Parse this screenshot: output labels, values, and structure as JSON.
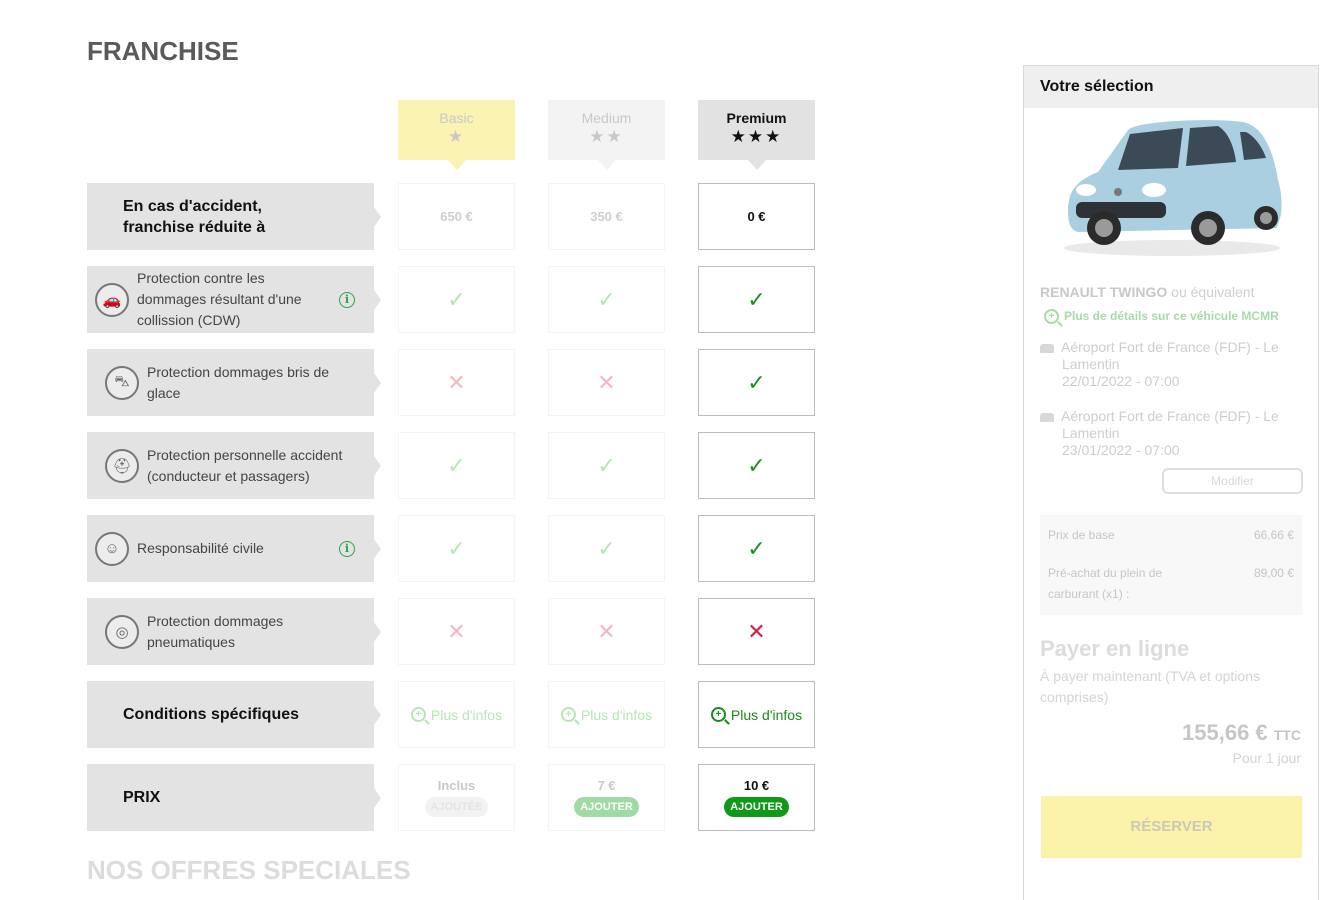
{
  "section_title": "FRANCHISE",
  "special_title": "NOS OFFRES SPECIALES",
  "plans": [
    {
      "name": "Basic",
      "stars": "★"
    },
    {
      "name": "Medium",
      "stars": "★★"
    },
    {
      "name": "Premium",
      "stars": "★★★"
    }
  ],
  "rows": {
    "franchise": {
      "label_line1": "En cas d'accident,",
      "label_line2": "franchise réduite à",
      "values": [
        "650 €",
        "350 €",
        "0 €"
      ]
    },
    "cdw": {
      "label": "Protection contre les dommages résultant d'une collission (CDW)",
      "icon": "car-crash-icon"
    },
    "glass": {
      "label": "Protection dommages bris de glace",
      "icon": "windshield-icon"
    },
    "personal": {
      "label": "Protection personnelle accident (conducteur et passagers)",
      "icon": "seatbelt-icon"
    },
    "liability": {
      "label": "Responsabilité civile",
      "icon": "driver-icon"
    },
    "tires": {
      "label": "Protection dommages pneumatiques",
      "icon": "tire-icon"
    },
    "conditions": {
      "label": "Conditions spécifiques",
      "link": "Plus d'infos"
    },
    "price": {
      "label": "PRIX",
      "values": [
        "Inclus",
        "7 €",
        "10 €"
      ],
      "buttons": [
        "AJOUTÉE",
        "AJOUTER",
        "AJOUTER"
      ]
    }
  },
  "glyphs": {
    "check": "✓",
    "cross": "✕",
    "info": "i",
    "plus": "+"
  },
  "sidebar": {
    "title": "Votre sélection",
    "car_name": "RENAULT TWINGO",
    "car_equiv": "ou équivalent",
    "car_link": "Plus de détails sur ce véhicule MCMR",
    "pickup": {
      "place": "Aéroport Fort de France (FDF) - Le Lamentin",
      "datetime": "22/01/2022 - 07:00"
    },
    "dropoff": {
      "place": "Aéroport Fort de France (FDF) - Le Lamentin",
      "datetime": "23/01/2022 - 07:00"
    },
    "modify": "Modifier",
    "base_price_label": "Prix de base",
    "base_price": "66,66 €",
    "fuel_label": "Pré-achat du plein de carburant (x1) :",
    "fuel_price": "89,00 €",
    "pay_title": "Payer en ligne",
    "pay_sub": "À payer maintenant (TVA et options comprises)",
    "total": "155,66 €",
    "total_suffix": "TTC",
    "per_day": "Pour 1 jour",
    "reserve": "RÉSERVER"
  },
  "colors": {
    "accent_green": "#0e9a18",
    "yellow": "#fbf3b2",
    "red": "#d0214a"
  }
}
